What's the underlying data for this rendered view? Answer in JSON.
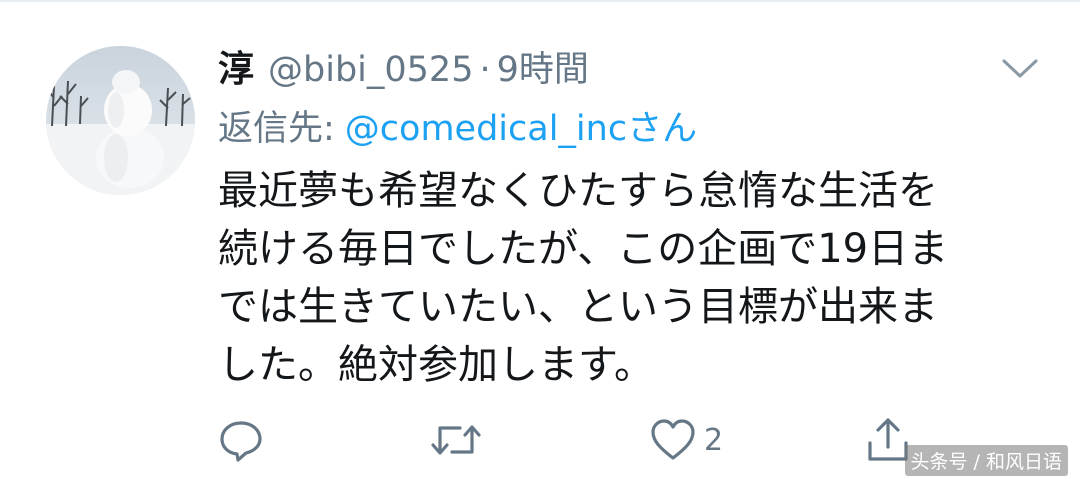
{
  "tweet": {
    "display_name": "淳",
    "handle": "@bibi_0525",
    "separator": "·",
    "time": "9時間",
    "reply_label": "返信先:",
    "reply_target": "@comedical_incさん",
    "body_lines": [
      "最近夢も希望なくひたすら怠惰な生活を",
      "続ける毎日でしたが、この企画で19日ま",
      "では生きていたい、という目標が出来ま",
      "した。絶対参加します。"
    ],
    "actions": {
      "reply_icon": "reply-icon",
      "retweet_icon": "retweet-icon",
      "like_icon": "heart-icon",
      "like_count": "2",
      "share_icon": "share-icon"
    }
  },
  "watermark": "头条号 / 和风日语",
  "colors": {
    "text": "#14171a",
    "secondary": "#657786",
    "accent": "#1da1f2",
    "icon": "#657786"
  }
}
